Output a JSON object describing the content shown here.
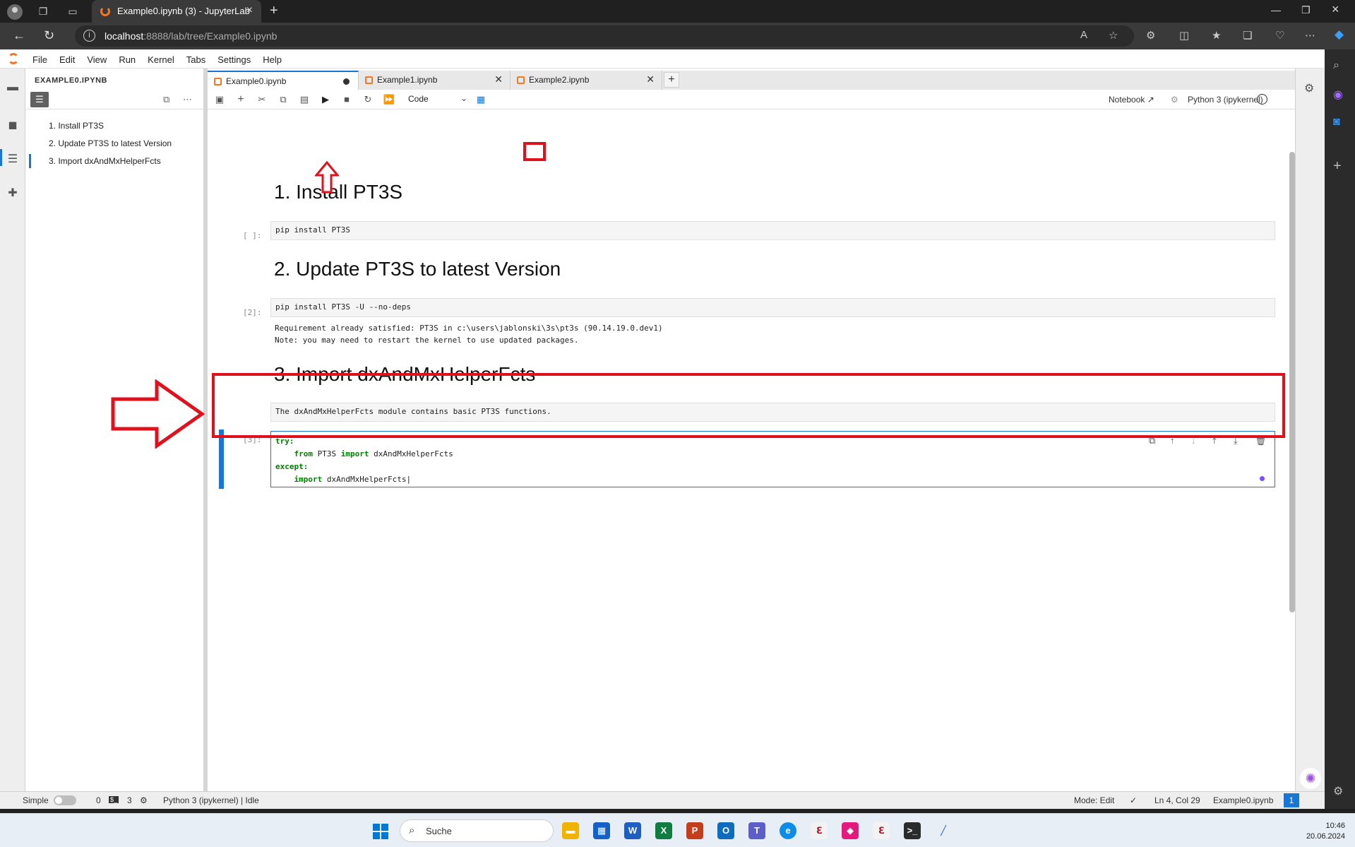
{
  "browser": {
    "tab_title": "Example0.ipynb (3) - JupyterLab",
    "url_host": "localhost",
    "url_rest": ":8888/lab/tree/Example0.ipynb"
  },
  "menu": [
    "File",
    "Edit",
    "View",
    "Run",
    "Kernel",
    "Tabs",
    "Settings",
    "Help"
  ],
  "toc": {
    "title": "EXAMPLE0.IPYNB",
    "items": [
      "1. Install PT3S",
      "2. Update PT3S to latest Version",
      "3. Import dxAndMxHelperFcts"
    ]
  },
  "doc_tabs": [
    "Example0.ipynb",
    "Example1.ipynb",
    "Example2.ipynb"
  ],
  "toolbar": {
    "cell_type": "Code",
    "notebook_label": "Notebook",
    "kernel": "Python 3 (ipykernel)"
  },
  "notebook": {
    "h1": "1. Install PT3S",
    "p1": "[ ]:",
    "c1": "pip install PT3S",
    "h2": "2. Update PT3S to latest Version",
    "p2": "[2]:",
    "c2": "pip install PT3S -U --no-deps",
    "o2a": "Requirement already satisfied: PT3S in c:\\users\\jablonski\\3s\\pt3s (90.14.19.0.dev1)",
    "o2b": "Note: you may need to restart the kernel to use updated packages.",
    "h3": "3. Import dxAndMxHelperFcts",
    "md3": "The dxAndMxHelperFcts module contains basic PT3S functions.",
    "p3": "[3]:",
    "code3": {
      "l1_kw": "try:",
      "l2_kw_from": "from",
      "l2_mod": "PT3S",
      "l2_kw_import": "import",
      "l2_name": "dxAndMxHelperFcts",
      "l3_kw": "except:",
      "l4_kw": "import",
      "l4_name": "dxAndMxHelperFcts"
    }
  },
  "status": {
    "mode_label": "Simple",
    "count1": "0",
    "count2": "3",
    "kernel_status": "Python 3 (ipykernel) | Idle",
    "mode": "Mode: Edit",
    "position": "Ln 4, Col 29",
    "file": "Example0.ipynb",
    "badge": "1"
  },
  "taskbar": {
    "search": "Suche",
    "time": "10:46",
    "date": "20.06.2024"
  }
}
